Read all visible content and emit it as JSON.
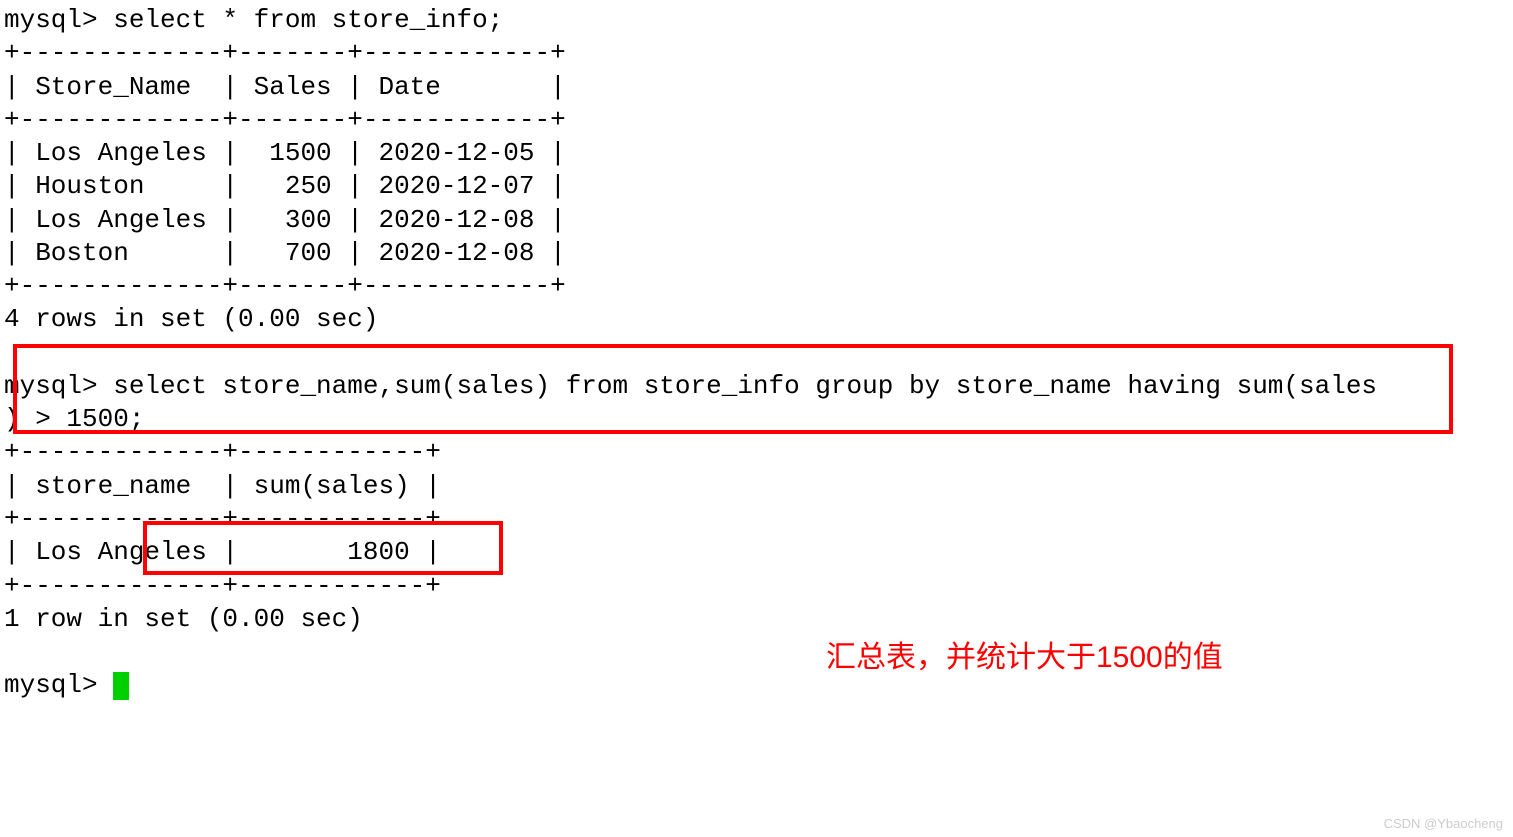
{
  "terminal": {
    "prompt": "mysql> ",
    "query1": "select * from store_info;",
    "table1_sep": "+-------------+-------+------------+",
    "table1_header": "| Store_Name  | Sales | Date       |",
    "table1_rows": [
      "| Los Angeles |  1500 | 2020-12-05 |",
      "| Houston     |   250 | 2020-12-07 |",
      "| Los Angeles |   300 | 2020-12-08 |",
      "| Boston      |   700 | 2020-12-08 |"
    ],
    "result1_status": "4 rows in set (0.00 sec)",
    "query2_line1": "select store_name,sum(sales) from store_info group by store_name having sum(sales",
    "query2_line2": ") > 1500;",
    "table2_sep": "+-------------+------------+",
    "table2_header": "| store_name  | sum(sales) |",
    "table2_rows": [
      "| Los Angeles |       1800 |"
    ],
    "result2_status": "1 row in set (0.00 sec)"
  },
  "annotation": "汇总表，并统计大于1500的值",
  "watermark": "CSDN @Ybaocheng",
  "chart_data": {
    "type": "table",
    "tables": [
      {
        "title": "store_info",
        "columns": [
          "Store_Name",
          "Sales",
          "Date"
        ],
        "rows": [
          [
            "Los Angeles",
            1500,
            "2020-12-05"
          ],
          [
            "Houston",
            250,
            "2020-12-07"
          ],
          [
            "Los Angeles",
            300,
            "2020-12-08"
          ],
          [
            "Boston",
            700,
            "2020-12-08"
          ]
        ]
      },
      {
        "title": "group by having sum > 1500",
        "columns": [
          "store_name",
          "sum(sales)"
        ],
        "rows": [
          [
            "Los Angeles",
            1800
          ]
        ]
      }
    ]
  }
}
